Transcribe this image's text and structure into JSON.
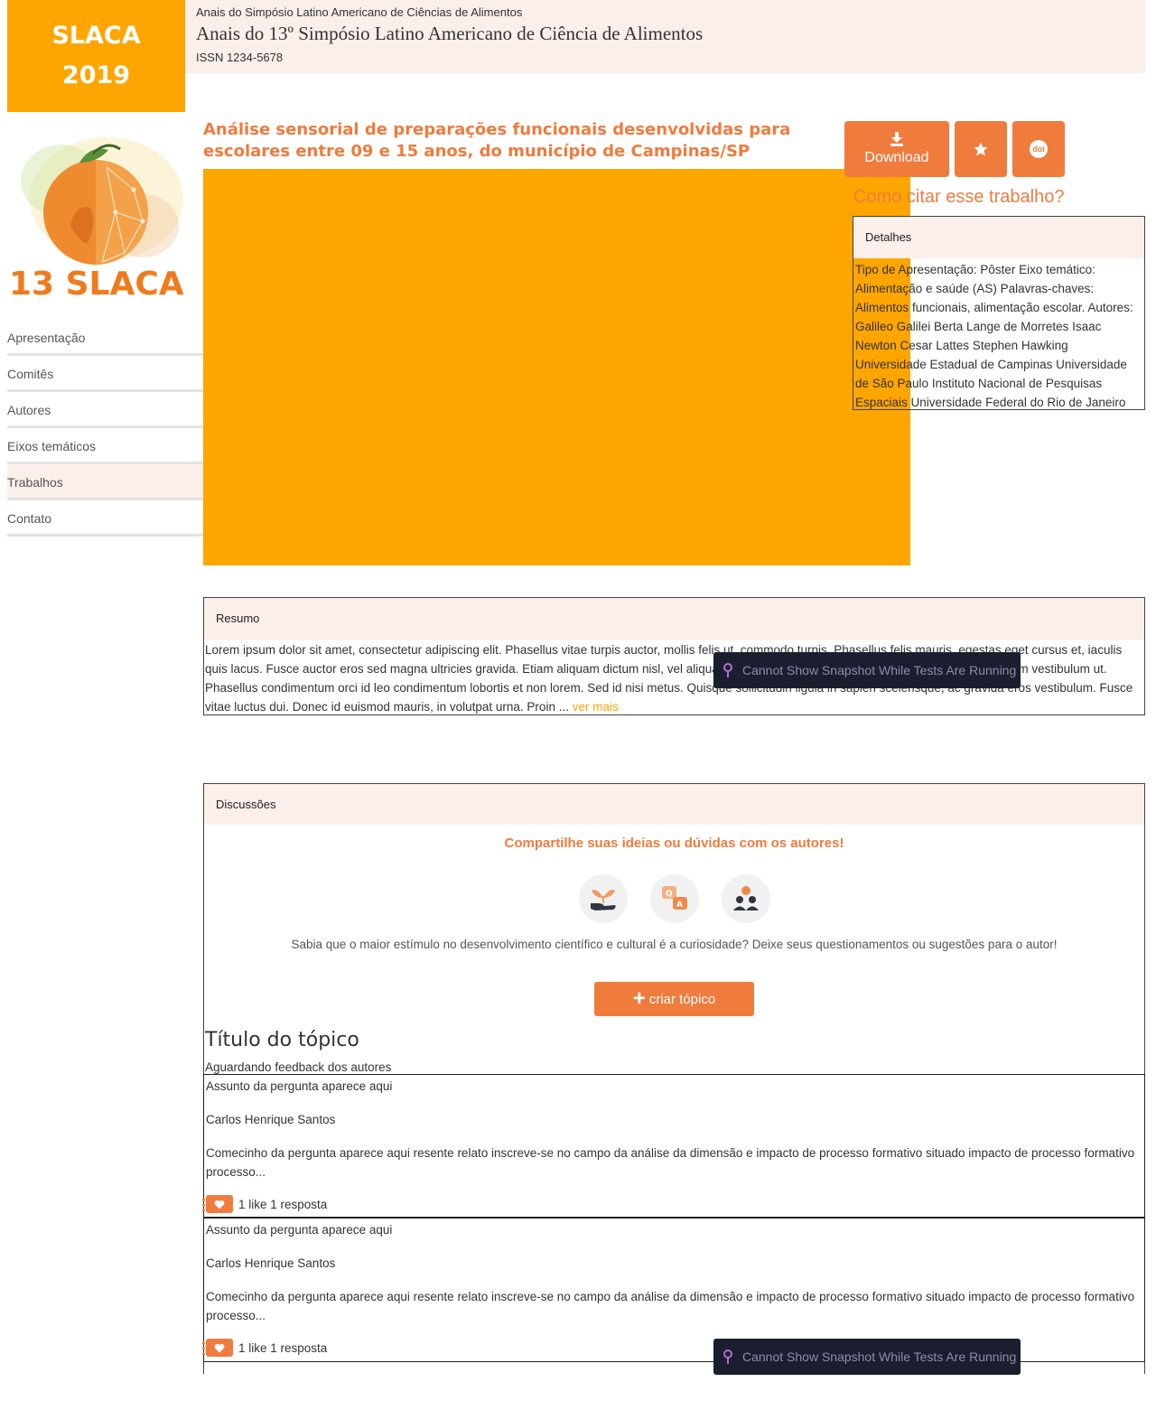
{
  "header": {
    "logo_line1": "SLACA",
    "logo_line2": "2019",
    "event_name": "Anais do Simpósio Latino Americano de Ciências de Alimentos",
    "proceedings_title": "Anais do 13º Simpósio Latino Americano de Ciência de Alimentos",
    "issn": "ISSN 1234-5678"
  },
  "event_art": {
    "label": "13 SLACA"
  },
  "sidebar": {
    "items": [
      {
        "label": "Apresentação"
      },
      {
        "label": "Comitês"
      },
      {
        "label": "Autores"
      },
      {
        "label": "Eixos temáticos"
      },
      {
        "label": "Trabalhos",
        "active": true
      },
      {
        "label": "Contato"
      }
    ]
  },
  "work": {
    "title": "Análise sensorial de preparações funcionais desenvolvidas para escolares entre 09 e 15 anos, do município de Campinas/SP"
  },
  "actions": {
    "download_label": "Download",
    "download_icon": "download-icon",
    "star_icon": "star-icon",
    "doi_icon": "doi-icon",
    "doi_text": "doi"
  },
  "cite": {
    "title": "Como citar esse trabalho?"
  },
  "details": {
    "heading": "Detalhes",
    "body": "Tipo de Apresentação: Pôster Eixo temático: Alimentação e saúde (AS) Palavras-chaves: Alimentos funcionais, alimentação escolar. Autores: Galileo Galilei Berta Lange de Morretes Isaac Newton Cesar Lattes Stephen Hawking Universidade Estadual de Campinas Universidade de São Paulo Instituto Nacional de Pesquisas Espaciais Universidade Federal do Rio de Janeiro"
  },
  "resumo": {
    "heading": "Resumo",
    "body": "Lorem ipsum dolor sit amet, consectetur adipiscing elit. Phasellus vitae turpis auctor, mollis felis ut, commodo turpis. Phasellus felis mauris, egestas eget cursus et, iaculis quis lacus. Fusce auctor eros sed magna ultricies gravida. Etiam aliquam dictum nisl, vel aliquam est vehicula ut. Nullam eu varius diam, at viverra lorem vestibulum ut. Phasellus condimentum orci id leo condimentum lobortis et non lorem. Sed id nisi metus. Quisque sollicitudin ligula in sapien scelerisque, ac gravida eros vestibulum. Fusce vitae luctus dui. Donec id euismod mauris, in volutpat urna. Proin ... ",
    "more_label": "ver mais"
  },
  "discussions": {
    "heading": "Discussões",
    "cta": "Compartilhe suas ideias ou dúvidas com os autores!",
    "text": "Sabia que o maior estímulo no desenvolvimento científico e cultural é a curiosidade? Deixe seus questionamentos ou sugestões para o autor!",
    "create_label": "criar tópico",
    "topic_title": "Título do tópico",
    "topic_status": "Aguardando feedback dos autores",
    "questions": [
      {
        "subject": "Assunto da pergunta aparece aqui",
        "author": "Carlos Henrique Santos",
        "excerpt": "Comecinho da pergunta aparece aqui resente relato inscreve-se no campo da análise da dimensão e impacto de processo formativo situado impacto de processo formativo processo...",
        "stats": "1 like 1 resposta"
      },
      {
        "subject": "Assunto da pergunta aparece aqui",
        "author": "Carlos Henrique Santos",
        "excerpt": "Comecinho da pergunta aparece aqui resente relato inscreve-se no campo da análise da dimensão e impacto de processo formativo situado impacto de processo formativo processo...",
        "stats": "1 like 1 resposta"
      }
    ]
  },
  "overlay": {
    "toast_text": "Cannot Show Snapshot While Tests Are Running"
  },
  "colors": {
    "brand_orange": "#ffa500",
    "accent": "#ef7b3d",
    "panel_bg": "#fbefea",
    "toast_bg": "#1b1e2e"
  }
}
